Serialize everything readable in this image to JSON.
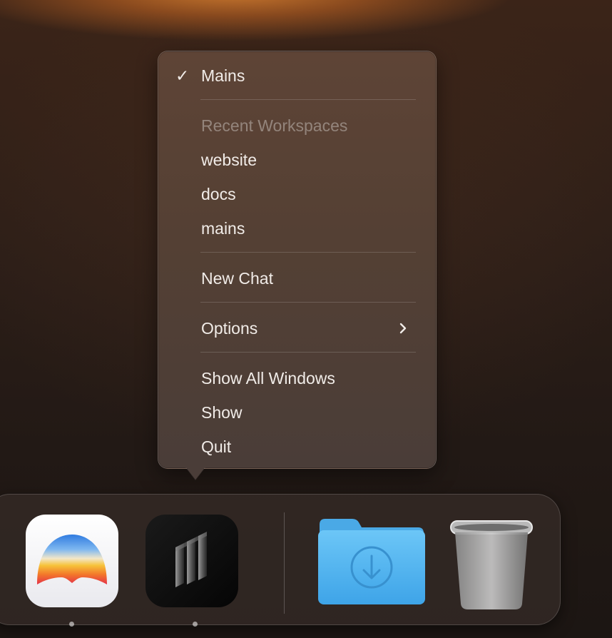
{
  "menu": {
    "current_workspace": "Mains",
    "recent_header": "Recent Workspaces",
    "recent_items": [
      "website",
      "docs",
      "mains"
    ],
    "new_chat": "New Chat",
    "options": "Options",
    "show_all_windows": "Show All Windows",
    "show": "Show",
    "quit": "Quit"
  },
  "dock": {
    "apps": [
      {
        "icon": "rainbow-arc-app-icon",
        "running": true
      },
      {
        "icon": "pillars-app-icon",
        "running": true
      },
      {
        "icon": "downloads-folder-icon",
        "running": false
      },
      {
        "icon": "trash-icon",
        "running": false
      }
    ]
  },
  "colors": {
    "menu_text": "#f1ece8",
    "folder_blue": "#5bb8f0"
  }
}
